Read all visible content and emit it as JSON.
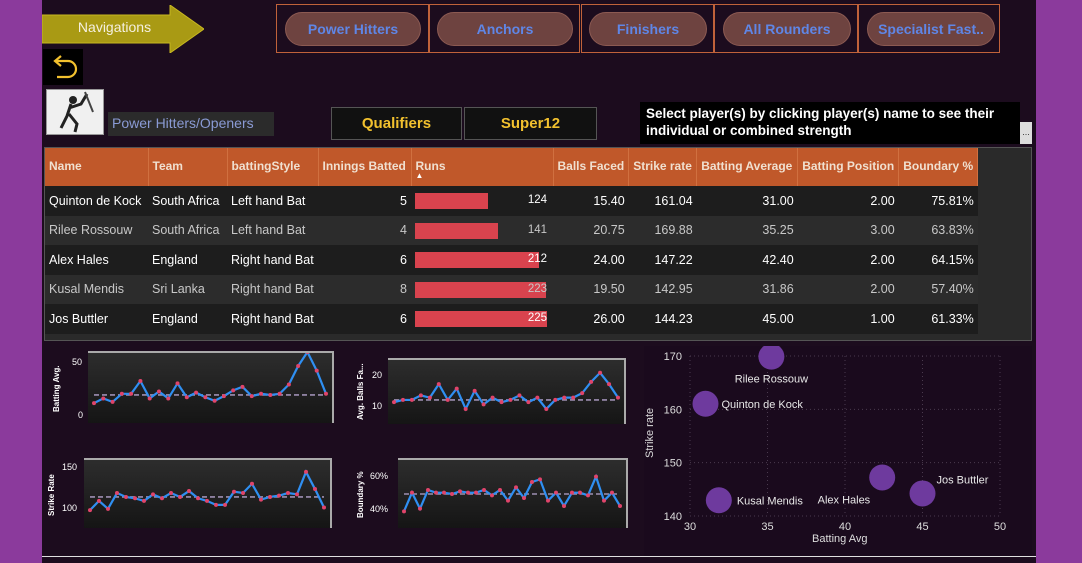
{
  "nav": {
    "label": "Navigations",
    "categories": [
      "Power Hitters",
      "Anchors",
      "Finishers",
      "All Rounders",
      "Specialist Fast.."
    ]
  },
  "section_title": "Power Hitters/Openers",
  "stages": [
    "Qualifiers",
    "Super12"
  ],
  "info": "Select player(s) by clicking player(s) name to see their individual or combined strength",
  "info_more": "...",
  "table": {
    "headers": [
      "Name",
      "Team",
      "battingStyle",
      "Innings Batted",
      "Runs",
      "Balls Faced",
      "Strike rate",
      "Batting Average",
      "Batting Position",
      "Boundary %"
    ],
    "sort_indicator": "▲",
    "rows": [
      {
        "name": "Quinton de Kock",
        "team": "South Africa",
        "style": "Left hand Bat",
        "innings": "5",
        "runs": "124",
        "runs_value": 124,
        "balls": "15.40",
        "sr": "161.04",
        "avg": "31.00",
        "pos": "2.00",
        "boundary": "75.81%"
      },
      {
        "name": "Rilee Rossouw",
        "team": "South Africa",
        "style": "Left hand Bat",
        "innings": "4",
        "runs": "141",
        "runs_value": 141,
        "balls": "20.75",
        "sr": "169.88",
        "avg": "35.25",
        "pos": "3.00",
        "boundary": "63.83%"
      },
      {
        "name": "Alex Hales",
        "team": "England",
        "style": "Right hand Bat",
        "innings": "6",
        "runs": "212",
        "runs_value": 212,
        "balls": "24.00",
        "sr": "147.22",
        "avg": "42.40",
        "pos": "2.00",
        "boundary": "64.15%"
      },
      {
        "name": "Kusal Mendis",
        "team": "Sri Lanka",
        "style": "Right hand Bat",
        "innings": "8",
        "runs": "223",
        "runs_value": 223,
        "balls": "19.50",
        "sr": "142.95",
        "avg": "31.86",
        "pos": "2.00",
        "boundary": "57.40%"
      },
      {
        "name": "Jos Buttler",
        "team": "England",
        "style": "Right hand Bat",
        "innings": "6",
        "runs": "225",
        "runs_value": 225,
        "balls": "26.00",
        "sr": "144.23",
        "avg": "45.00",
        "pos": "1.00",
        "boundary": "61.33%"
      }
    ],
    "runs_max": 225
  },
  "mini_charts": [
    {
      "ylabel": "Batting Avg.",
      "ticks": [
        "50",
        "0"
      ],
      "min": 0,
      "max": 50,
      "ref": 19,
      "values": [
        12,
        16,
        13,
        20,
        20,
        31,
        16,
        22,
        16,
        29,
        17,
        21,
        17,
        14,
        18,
        23,
        26,
        18,
        20,
        19,
        20,
        28,
        44,
        56,
        40,
        20
      ]
    },
    {
      "ylabel": "Avg. Balls Fa...",
      "ticks": [
        "20",
        "10"
      ],
      "min": 5,
      "max": 28,
      "ref": 13,
      "values": [
        12,
        13,
        13,
        15,
        14,
        20,
        13,
        18,
        9,
        17,
        11,
        14,
        12,
        13,
        15,
        12,
        14,
        9,
        13,
        14,
        14,
        16,
        21,
        25,
        20,
        14
      ]
    },
    {
      "ylabel": "Strike Rate",
      "ticks": [
        "150",
        "100"
      ],
      "min": 80,
      "max": 165,
      "ref": 118,
      "values": [
        98,
        112,
        100,
        124,
        118,
        116,
        112,
        122,
        116,
        124,
        118,
        127,
        116,
        112,
        106,
        106,
        126,
        124,
        138,
        114,
        118,
        120,
        124,
        122,
        156,
        130,
        102
      ]
    },
    {
      "ylabel": "Boundary %",
      "ticks": [
        "60%",
        "40%"
      ],
      "min": 30,
      "max": 72,
      "ref": 51,
      "values": [
        38,
        52,
        40,
        54,
        52,
        52,
        51,
        53,
        52,
        52,
        54,
        50,
        54,
        46,
        56,
        48,
        60,
        62,
        46,
        52,
        42,
        52,
        52,
        50,
        64,
        46,
        52,
        42
      ]
    }
  ],
  "chart_data": {
    "type": "scatter",
    "xlabel": "Batting Avg",
    "ylabel": "Strike rate",
    "xlim": [
      30,
      50
    ],
    "ylim": [
      140,
      170
    ],
    "xticks": [
      "30",
      "35",
      "40",
      "45",
      "50"
    ],
    "yticks": [
      "170",
      "160",
      "150",
      "140"
    ],
    "grid": true,
    "points": [
      {
        "label": "Quinton de Kock",
        "x": 31.0,
        "y": 161.04
      },
      {
        "label": "Rilee Rossouw",
        "x": 35.25,
        "y": 169.88
      },
      {
        "label": "Alex Hales",
        "x": 42.4,
        "y": 147.22
      },
      {
        "label": "Kusal Mendis",
        "x": 31.86,
        "y": 142.95
      },
      {
        "label": "Jos Buttler",
        "x": 45.0,
        "y": 144.23
      }
    ],
    "marker_color": "#6e3a9e"
  },
  "colors": {
    "header": "#c0582a",
    "runs_bar": "#d9434e",
    "line": "#2f8ff2",
    "point": "#e0446a",
    "ref_line": "#9d8fb2",
    "side": "#8b3a9c"
  },
  "icons": {
    "back": "back-arrow-icon",
    "player": "batsman-image-icon"
  }
}
